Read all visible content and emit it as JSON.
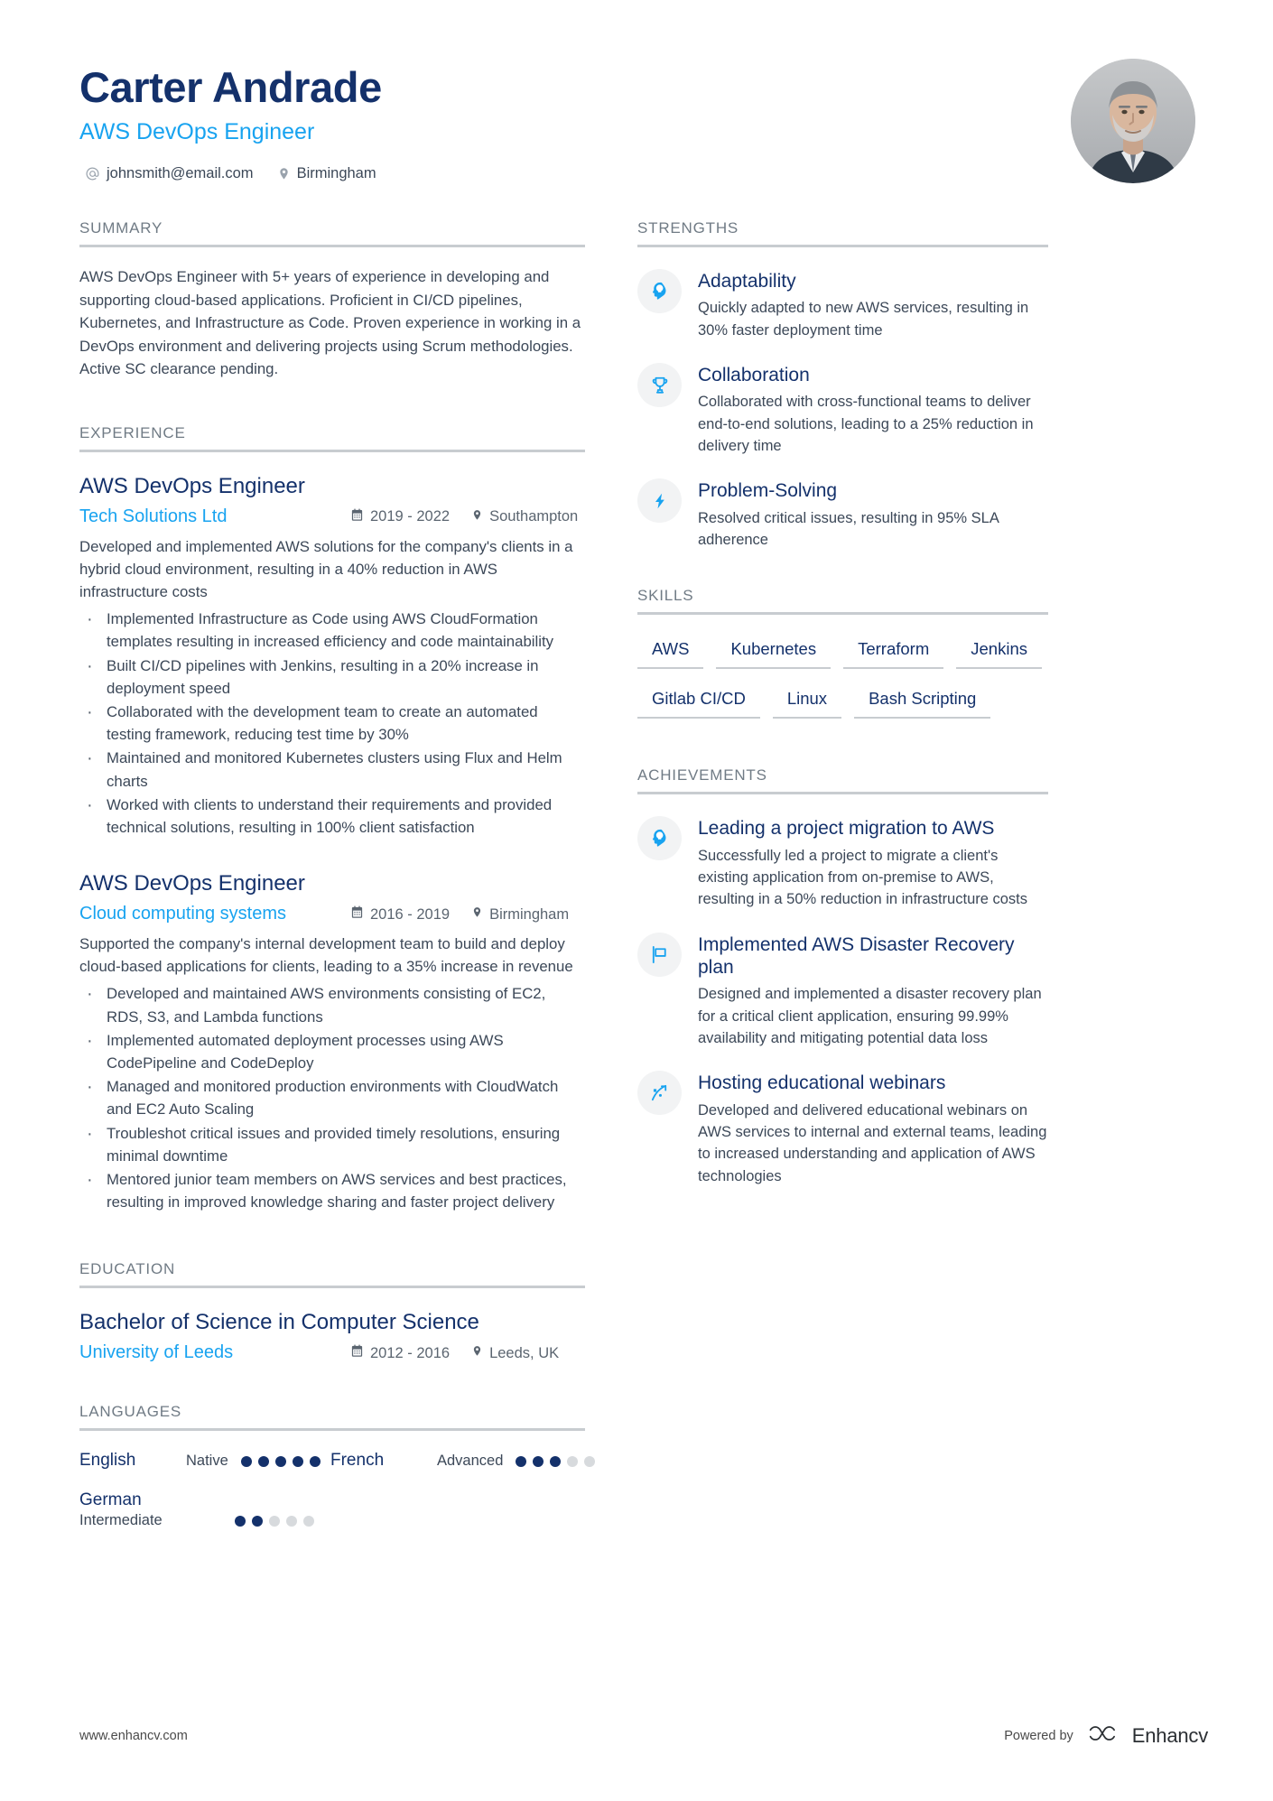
{
  "colors": {
    "navy": "#14316b",
    "accent_blue": "#18a3f0",
    "body_text": "#3c4858",
    "muted": "#707b85",
    "rule": "#c8ccd0"
  },
  "header": {
    "full_name": "Carter Andrade",
    "job_title": "AWS DevOps Engineer",
    "email": "johnsmith@email.com",
    "location": "Birmingham",
    "email_icon": "at-icon",
    "location_icon": "map-pin-icon",
    "avatar_icon": "profile-photo"
  },
  "summary": {
    "title": "SUMMARY",
    "text": "AWS DevOps Engineer with 5+ years of experience in developing and supporting cloud-based applications. Proficient in CI/CD pipelines, Kubernetes, and Infrastructure as Code. Proven experience in working in a DevOps environment and delivering projects using Scrum methodologies. Active SC clearance pending."
  },
  "experience": {
    "title": "EXPERIENCE",
    "items": [
      {
        "role": "AWS DevOps Engineer",
        "company": "Tech Solutions Ltd",
        "date": "2019 - 2022",
        "location": "Southampton",
        "date_icon": "calendar-icon",
        "location_icon": "map-pin-icon",
        "description": "Developed and implemented AWS solutions for the company's clients in a hybrid cloud environment, resulting in a 40% reduction in AWS infrastructure costs",
        "bullets": [
          "Implemented Infrastructure as Code using AWS CloudFormation templates resulting in increased efficiency and code maintainability",
          "Built CI/CD pipelines with Jenkins, resulting in a 20% increase in deployment speed",
          "Collaborated with the development team to create an automated testing framework, reducing test time by 30%",
          "Maintained and monitored Kubernetes clusters using Flux and Helm charts",
          "Worked with clients to understand their requirements and provided technical solutions, resulting in 100% client satisfaction"
        ]
      },
      {
        "role": "AWS DevOps Engineer",
        "company": "Cloud computing systems",
        "date": "2016 - 2019",
        "location": "Birmingham",
        "date_icon": "calendar-icon",
        "location_icon": "map-pin-icon",
        "description": "Supported the company's internal development team to build and deploy cloud-based applications for clients, leading to a 35% increase in revenue",
        "bullets": [
          "Developed and maintained AWS environments consisting of EC2, RDS, S3, and Lambda functions",
          "Implemented automated deployment processes using AWS CodePipeline and CodeDeploy",
          "Managed and monitored production environments with CloudWatch and EC2 Auto Scaling",
          "Troubleshot critical issues and provided timely resolutions, ensuring minimal downtime",
          "Mentored junior team members on AWS services and best practices, resulting in improved knowledge sharing and faster project delivery"
        ]
      }
    ]
  },
  "education": {
    "title": "EDUCATION",
    "items": [
      {
        "degree": "Bachelor of Science in Computer Science",
        "institution": "University of Leeds",
        "date": "2012 - 2016",
        "location": "Leeds, UK",
        "date_icon": "calendar-icon",
        "location_icon": "map-pin-icon"
      }
    ]
  },
  "languages": {
    "title": "LANGUAGES",
    "items": [
      {
        "name": "English",
        "level": "Native",
        "dots_filled": 5,
        "dots_total": 5
      },
      {
        "name": "French",
        "level": "Advanced",
        "dots_filled": 3,
        "dots_total": 5
      },
      {
        "name": "German",
        "level": "Intermediate",
        "dots_filled": 2,
        "dots_total": 5
      }
    ]
  },
  "strengths": {
    "title": "STRENGTHS",
    "items": [
      {
        "icon": "brain-head-icon",
        "title": "Adaptability",
        "description": "Quickly adapted to new AWS services, resulting in 30% faster deployment time"
      },
      {
        "icon": "trophy-icon",
        "title": "Collaboration",
        "description": "Collaborated with cross-functional teams to deliver end-to-end solutions, leading to a 25% reduction in delivery time"
      },
      {
        "icon": "lightning-bolt-icon",
        "title": "Problem-Solving",
        "description": "Resolved critical issues, resulting in 95% SLA adherence"
      }
    ]
  },
  "skills": {
    "title": "SKILLS",
    "items": [
      "AWS",
      "Kubernetes",
      "Terraform",
      "Jenkins",
      "Gitlab CI/CD",
      "Linux",
      "Bash Scripting"
    ]
  },
  "achievements": {
    "title": "ACHIEVEMENTS",
    "items": [
      {
        "icon": "brain-head-icon",
        "title": "Leading a project migration to AWS",
        "description": "Successfully led a project to migrate a client's existing application from on-premise to AWS, resulting in a 50% reduction in infrastructure costs"
      },
      {
        "icon": "flag-icon",
        "title": "Implemented AWS Disaster Recovery plan",
        "description": "Designed and implemented a disaster recovery plan for a critical client application, ensuring 99.99% availability and mitigating potential data loss"
      },
      {
        "icon": "trend-arrow-icon",
        "title": "Hosting educational webinars",
        "description": "Developed and delivered educational webinars on AWS services to internal and external teams, leading to increased understanding and application of AWS technologies"
      }
    ]
  },
  "footer": {
    "url": "www.enhancv.com",
    "powered_by": "Powered by",
    "brand": "Enhancv",
    "brand_icon": "enhancv-logo-icon"
  }
}
